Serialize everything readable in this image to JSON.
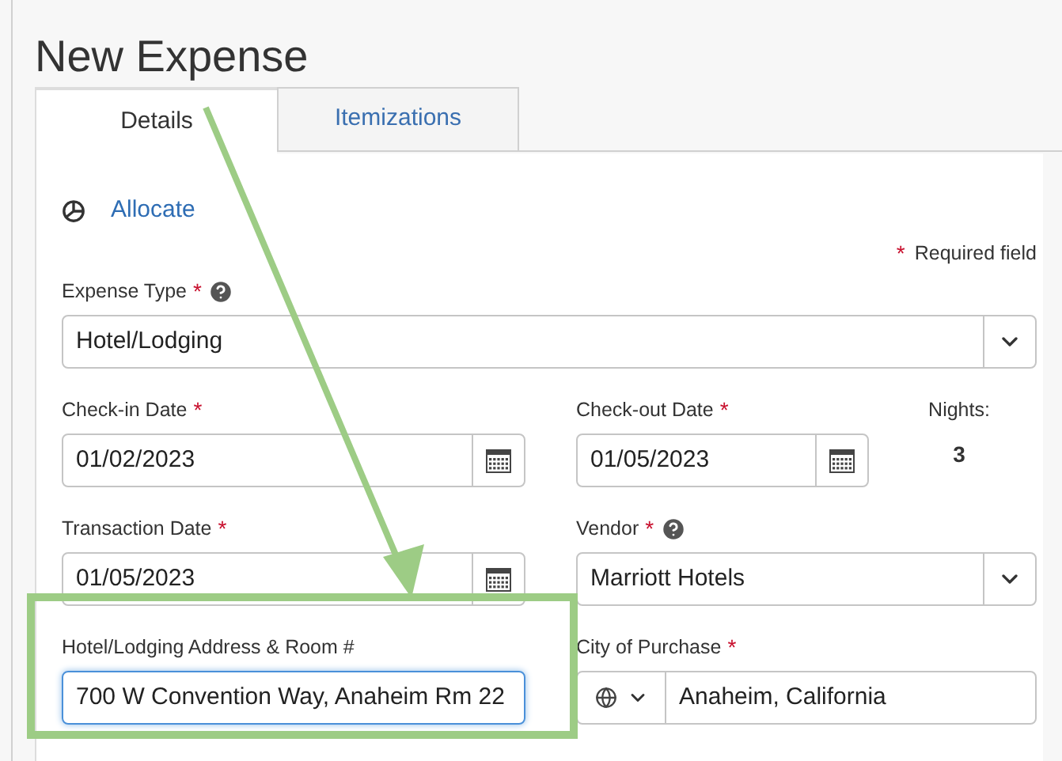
{
  "title": "New Expense",
  "tabs": [
    {
      "label": "Details",
      "selected": true
    },
    {
      "label": "Itemizations",
      "selected": false
    }
  ],
  "allocate_link": "Allocate",
  "required_note": {
    "mark": "*",
    "text": "Required field"
  },
  "expense_type": {
    "label": "Expense Type",
    "required": true,
    "help": true,
    "value": "Hotel/Lodging"
  },
  "check_in_date": {
    "label": "Check-in Date",
    "required": true,
    "value": "01/02/2023"
  },
  "check_out_date": {
    "label": "Check-out Date",
    "required": true,
    "value": "01/05/2023"
  },
  "nights": {
    "label": "Nights:",
    "value": "3"
  },
  "transaction_date": {
    "label": "Transaction Date",
    "required": true,
    "value": "01/05/2023"
  },
  "vendor": {
    "label": "Vendor",
    "required": true,
    "help": true,
    "value": "Marriott Hotels"
  },
  "address": {
    "label": "Hotel/Lodging Address & Room #",
    "required": false,
    "value": "700 W Convention Way, Anaheim Rm 22",
    "focused": true
  },
  "city_of_purchase": {
    "label": "City of Purchase",
    "required": true,
    "value": "Anaheim, California"
  }
}
